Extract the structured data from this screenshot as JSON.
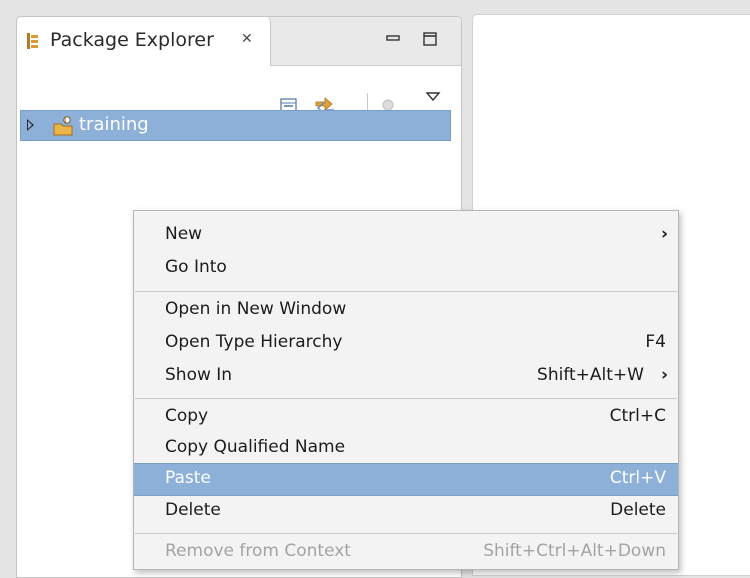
{
  "view": {
    "tab_label": "Package Explorer",
    "tab_icon": "package-explorer-icon",
    "close_icon": "close-tab-icon",
    "window_buttons": [
      "minimize-icon",
      "maximize-icon"
    ],
    "toolbar_icons": [
      "collapse-all-icon",
      "link-with-editor-icon",
      "focus-on-task-icon",
      "view-menu-icon"
    ]
  },
  "tree": {
    "items": [
      {
        "label": "training",
        "icon": "java-project-icon",
        "expanded": false,
        "selected": true
      }
    ]
  },
  "context_menu": {
    "items": [
      {
        "label": "New",
        "mnemonic": "w",
        "shortcut": "",
        "submenu": true,
        "disabled": false,
        "highlighted": false
      },
      {
        "label": "Go Into",
        "mnemonic": "I",
        "shortcut": "",
        "submenu": false,
        "disabled": false,
        "highlighted": false
      },
      {
        "label": "Open in New Window",
        "mnemonic": "N",
        "shortcut": "",
        "submenu": false,
        "disabled": false,
        "highlighted": false
      },
      {
        "label": "Open Type Hierarchy",
        "mnemonic": "n",
        "shortcut": "F4",
        "submenu": false,
        "disabled": false,
        "highlighted": false
      },
      {
        "label": "Show In",
        "mnemonic": "w",
        "shortcut": "Shift+Alt+W",
        "submenu": true,
        "disabled": false,
        "highlighted": false
      },
      {
        "label": "Copy",
        "mnemonic": "C",
        "shortcut": "Ctrl+C",
        "submenu": false,
        "disabled": false,
        "highlighted": false
      },
      {
        "label": "Copy Qualified Name",
        "mnemonic": "y",
        "shortcut": "",
        "submenu": false,
        "disabled": false,
        "highlighted": false
      },
      {
        "label": "Paste",
        "mnemonic": "P",
        "shortcut": "Ctrl+V",
        "submenu": false,
        "disabled": false,
        "highlighted": true
      },
      {
        "label": "Delete",
        "mnemonic": "D",
        "shortcut": "Delete",
        "submenu": false,
        "disabled": false,
        "highlighted": false
      },
      {
        "label": "Remove from Context",
        "mnemonic": "",
        "shortcut": "Shift+Ctrl+Alt+Down",
        "submenu": false,
        "disabled": true,
        "highlighted": false
      }
    ]
  },
  "colors": {
    "selection": "#8db0d9",
    "menu_background": "#f3f3f3",
    "disabled_text": "#a3a3a3"
  }
}
